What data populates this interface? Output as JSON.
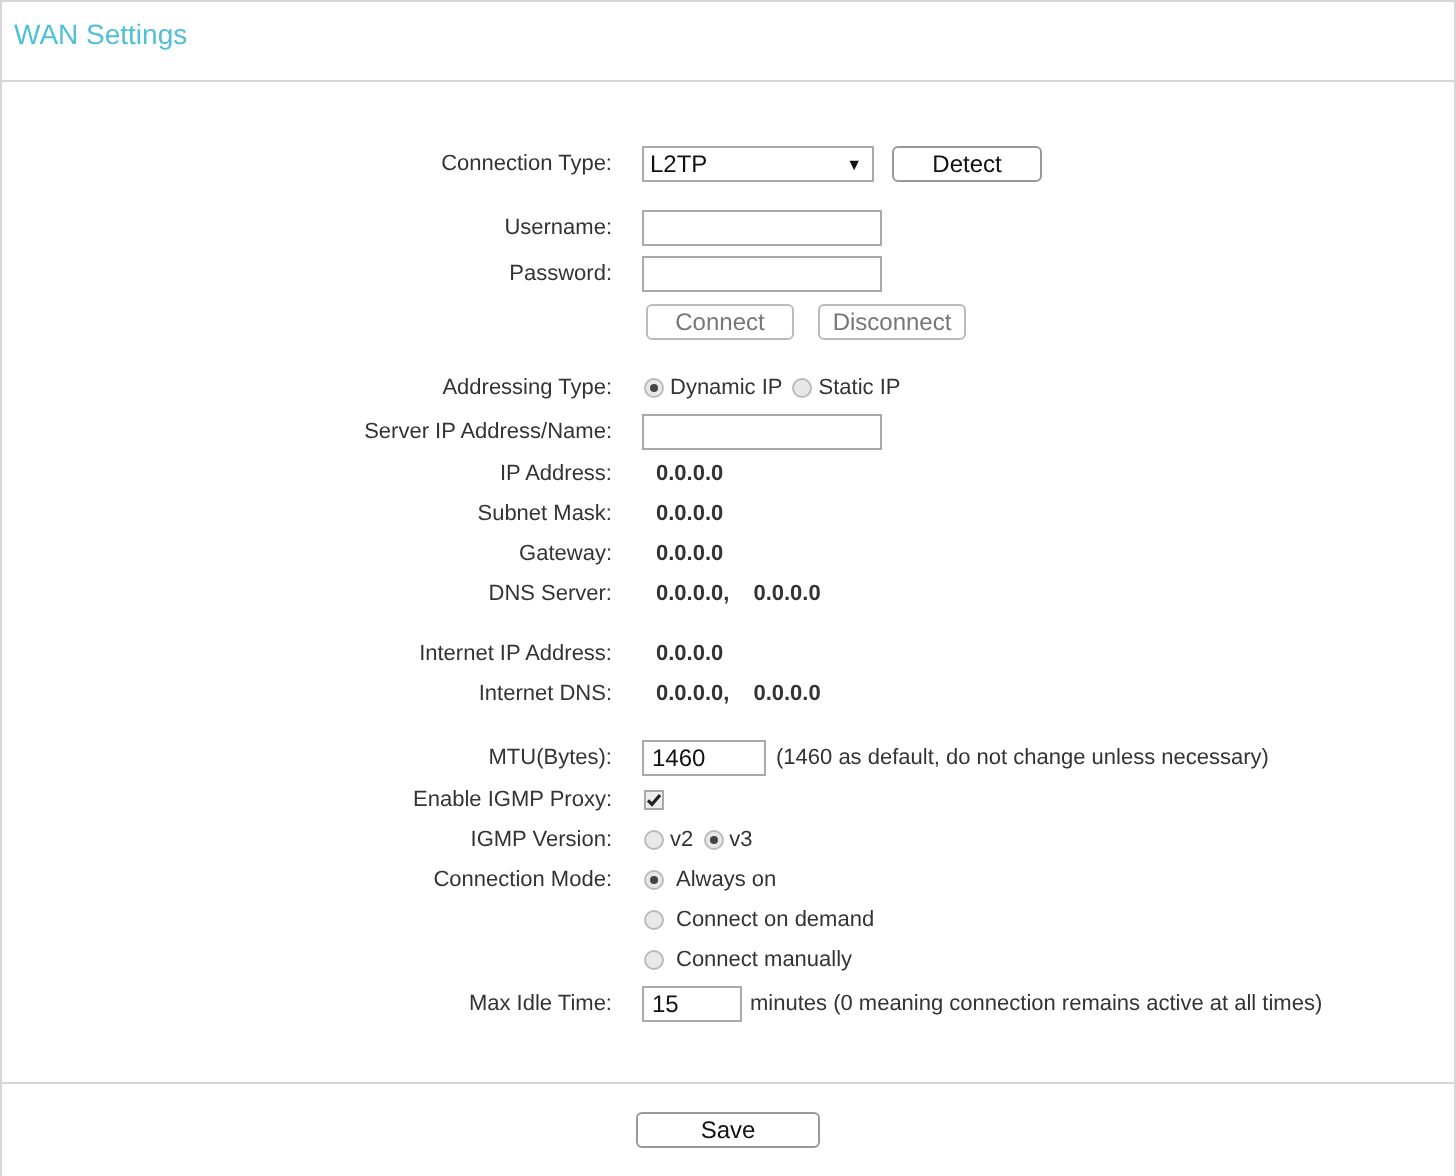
{
  "title": "WAN Settings",
  "sections": [
    {
      "rows": [
        {
          "kind": "select",
          "label": "Connection Type:",
          "value": "L2TP",
          "caret": "▼",
          "button": "Detect"
        }
      ]
    },
    {
      "rows": [
        {
          "kind": "input",
          "label": "Username:"
        },
        {
          "kind": "input",
          "label": "Password:"
        },
        {
          "kind": "buttons",
          "buttons": [
            {
              "label": "Connect",
              "disabled": true
            },
            {
              "label": "Disconnect",
              "disabled": true
            }
          ]
        }
      ]
    },
    {
      "rows": [
        {
          "kind": "radios",
          "label": "Addressing Type:",
          "options": [
            {
              "label": "Dynamic IP",
              "selected": true
            },
            {
              "label": "Static IP",
              "selected": false
            }
          ]
        },
        {
          "kind": "input",
          "label": "Server IP Address/Name:"
        },
        {
          "kind": "info",
          "label": "IP Address:",
          "values": [
            "0.0.0.0"
          ]
        },
        {
          "kind": "info",
          "label": "Subnet Mask:",
          "values": [
            "0.0.0.0"
          ]
        },
        {
          "kind": "info",
          "label": "Gateway:",
          "values": [
            "0.0.0.0"
          ]
        },
        {
          "kind": "info",
          "label": "DNS Server:",
          "values": [
            "0.0.0.0,",
            "0.0.0.0"
          ]
        }
      ]
    },
    {
      "rows": [
        {
          "kind": "info",
          "label": "Internet IP Address:",
          "values": [
            "0.0.0.0"
          ]
        },
        {
          "kind": "info",
          "label": "Internet DNS:",
          "values": [
            "0.0.0.0,",
            "0.0.0.0"
          ]
        }
      ]
    },
    {
      "rows": [
        {
          "kind": "input_note",
          "label": "MTU(Bytes):",
          "value": "1460",
          "note": "(1460 as default, do not change unless necessary)"
        },
        {
          "kind": "checkbox",
          "label": "Enable IGMP Proxy:",
          "checked": true
        },
        {
          "kind": "radios",
          "label": "IGMP Version:",
          "options": [
            {
              "label": "v2",
              "selected": false
            },
            {
              "label": "v3",
              "selected": true
            }
          ]
        },
        {
          "kind": "radio_list",
          "label": "Connection Mode:",
          "options": [
            {
              "label": "Always on",
              "selected": true
            },
            {
              "label": "Connect on demand",
              "selected": false
            },
            {
              "label": "Connect manually",
              "selected": false
            }
          ]
        },
        {
          "kind": "input_note",
          "label": "Max Idle Time:",
          "value": "15",
          "note": "minutes (0 meaning connection remains active at all times)"
        }
      ]
    }
  ],
  "save": "Save"
}
